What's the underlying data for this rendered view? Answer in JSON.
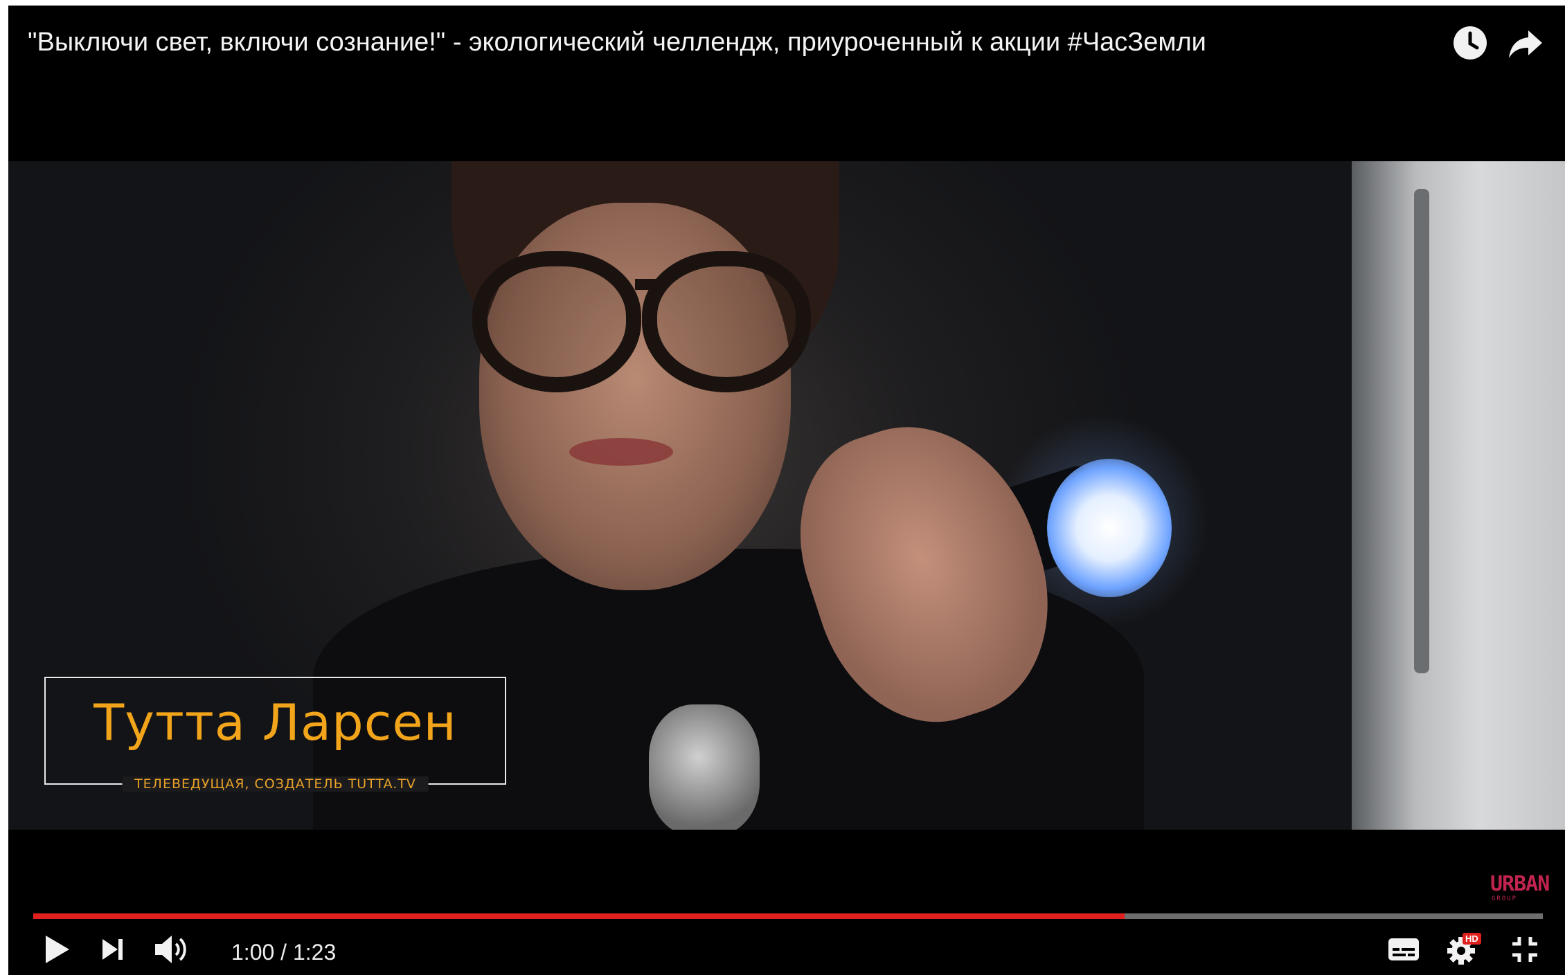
{
  "video": {
    "title": "\"Выключи свет, включи сознание!\" - экологический челлендж, приуроченный к акции #ЧасЗемли",
    "lower_third": {
      "name": "Тутта Ларсен",
      "subtitle": "ТЕЛЕВЕДУЩАЯ, СОЗДАТЕЛЬ TUTTA.TV"
    },
    "watermark": {
      "text": "URBAN",
      "subtext": "GROUP"
    }
  },
  "top_actions": {
    "watch_later_icon": "clock-icon",
    "share_icon": "share-arrow-icon"
  },
  "player": {
    "current_time": "1:00",
    "duration": "1:23",
    "time_display": "1:00 / 1:23",
    "progress_fraction": 0.7228,
    "settings_badge": "HD"
  },
  "controls": {
    "play_icon": "play-icon",
    "next_icon": "next-icon",
    "volume_icon": "volume-icon",
    "subtitles_icon": "subtitles-icon",
    "settings_icon": "gear-icon",
    "exit_fullscreen_icon": "exit-fullscreen-icon"
  },
  "colors": {
    "progress_played": "#e0201e",
    "lower_third_text": "#f2a51a",
    "watermark": "#c0244f",
    "hd_badge": "#e0201e"
  }
}
